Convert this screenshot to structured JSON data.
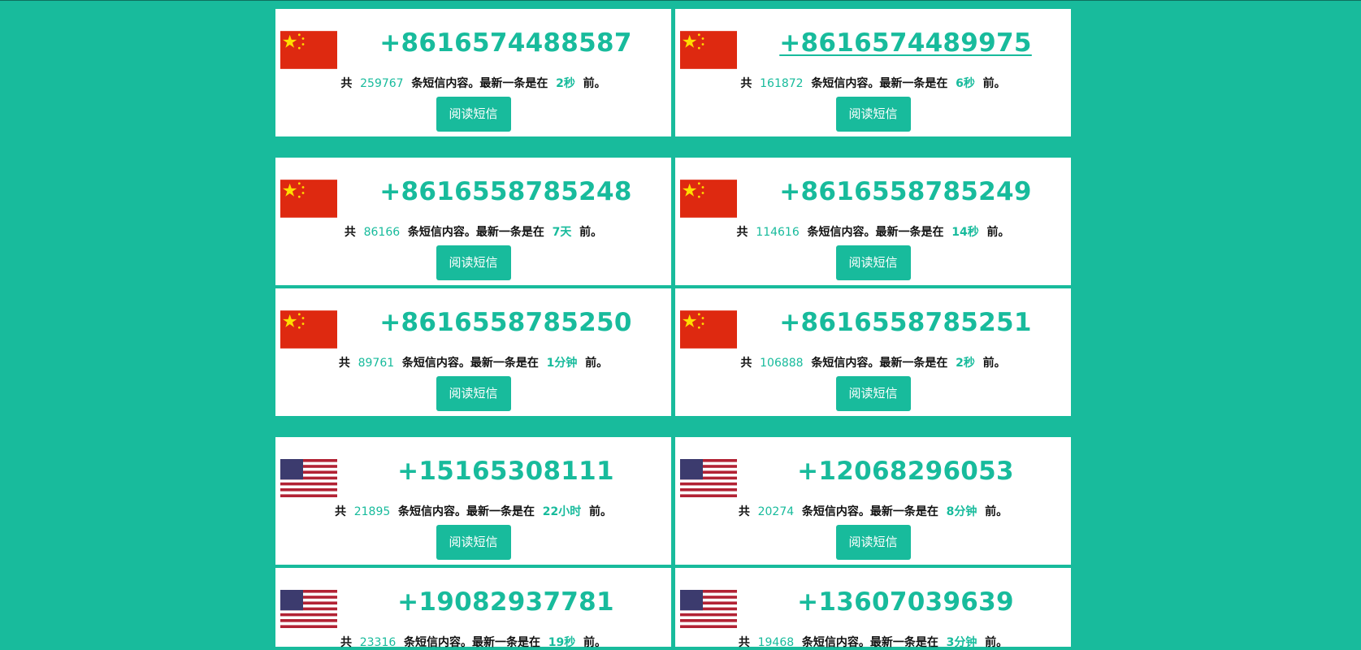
{
  "labels": {
    "prefix": "共",
    "middle": "条短信内容。最新一条是在",
    "suffix": "前。",
    "button": "阅读短信"
  },
  "cards": [
    {
      "number": "+8616574488587",
      "count": "259767",
      "time": "2秒",
      "country": "cn"
    },
    {
      "number": "+8616574489975",
      "count": "161872",
      "time": "6秒",
      "country": "cn"
    },
    {
      "number": "+8616558785248",
      "count": "86166",
      "time": "7天",
      "country": "cn"
    },
    {
      "number": "+8616558785249",
      "count": "114616",
      "time": "14秒",
      "country": "cn"
    },
    {
      "number": "+8616558785250",
      "count": "89761",
      "time": "1分钟",
      "country": "cn"
    },
    {
      "number": "+8616558785251",
      "count": "106888",
      "time": "2秒",
      "country": "cn"
    },
    {
      "number": "+15165308111",
      "count": "21895",
      "time": "22小时",
      "country": "us"
    },
    {
      "number": "+12068296053",
      "count": "20274",
      "time": "8分钟",
      "country": "us"
    },
    {
      "number": "+19082937781",
      "count": "23316",
      "time": "19秒",
      "country": "us"
    },
    {
      "number": "+13607039639",
      "count": "19468",
      "time": "3分钟",
      "country": "us"
    }
  ],
  "colors": {
    "accent": "#18bb9c",
    "card": "#ffffff",
    "cn_red": "#de2910",
    "cn_star": "#ffde00",
    "us_blue": "#3c3b6e",
    "us_red": "#b22234"
  }
}
